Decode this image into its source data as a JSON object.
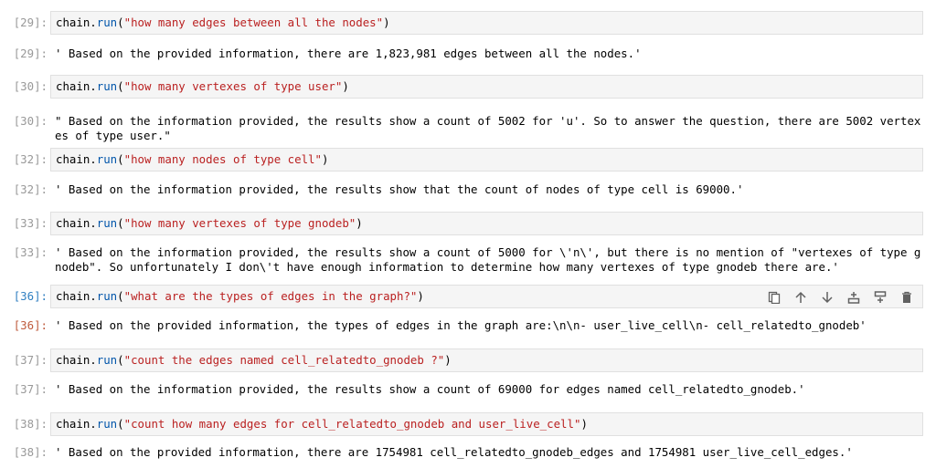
{
  "cells": [
    {
      "in_prompt": "[29]:",
      "obj": "chain.",
      "fn": "run",
      "open": "(",
      "arg": "\"how many edges between all the nodes\"",
      "close": ")",
      "out_prompt": "[29]:",
      "output": "' Based on the provided information, there are 1,823,981 edges between all the nodes.'"
    },
    {
      "in_prompt": "[30]:",
      "obj": "chain.",
      "fn": "run",
      "open": "(",
      "arg": "\"how many vertexes of type user\"",
      "close": ")",
      "out_prompt": "[30]:",
      "output": "\" Based on the information provided, the results show a count of 5002 for 'u'. So to answer the question, there are 5002 vertexes of type user.\""
    },
    {
      "in_prompt": "[32]:",
      "obj": "chain.",
      "fn": "run",
      "open": "(",
      "arg": "\"how many nodes of type cell\"",
      "close": ")",
      "out_prompt": "[32]:",
      "output": "' Based on the information provided, the results show that the count of nodes of type cell is 69000.'"
    },
    {
      "in_prompt": "[33]:",
      "obj": "chain.",
      "fn": "run",
      "open": "(",
      "arg": "\"how many vertexes of type gnodeb\"",
      "close": ")",
      "out_prompt": "[33]:",
      "output": "' Based on the information provided, the results show a count of 5000 for \\'n\\', but there is no mention of \"vertexes of type gnodeb\". So unfortunately I don\\'t have enough information to determine how many vertexes of type gnodeb there are.'"
    },
    {
      "in_prompt": "[36]:",
      "obj": "chain.",
      "fn": "run",
      "open": "(",
      "arg": "\"what are the types of edges in the graph?\"",
      "close": ")",
      "out_prompt": "[36]:",
      "output": "' Based on the provided information, the types of edges in the graph are:\\n\\n- user_live_cell\\n- cell_relatedto_gnodeb'"
    },
    {
      "in_prompt": "[37]:",
      "obj": "chain.",
      "fn": "run",
      "open": "(",
      "arg": "\"count the edges named cell_relatedto_gnodeb ?\"",
      "close": ")",
      "out_prompt": "[37]:",
      "output": "' Based on the information provided, the results show a count of 69000 for edges named cell_relatedto_gnodeb.'"
    },
    {
      "in_prompt": "[38]:",
      "obj": "chain.",
      "fn": "run",
      "open": "(",
      "arg": "\"count how many edges for cell_relatedto_gnodeb and user_live_cell\"",
      "close": ")",
      "out_prompt": "[38]:",
      "output": "' Based on the provided information, there are 1754981 cell_relatedto_gnodeb_edges and 1754981 user_live_cell_edges.'"
    }
  ],
  "toolbar_icons": [
    "duplicate-icon",
    "move-up-icon",
    "move-down-icon",
    "insert-above-icon",
    "insert-below-icon",
    "delete-icon"
  ],
  "colors": {
    "active_prompt": "#307fc1",
    "active_out_prompt": "#bf5b3d",
    "string": "#ba2121",
    "function": "#0055aa"
  }
}
